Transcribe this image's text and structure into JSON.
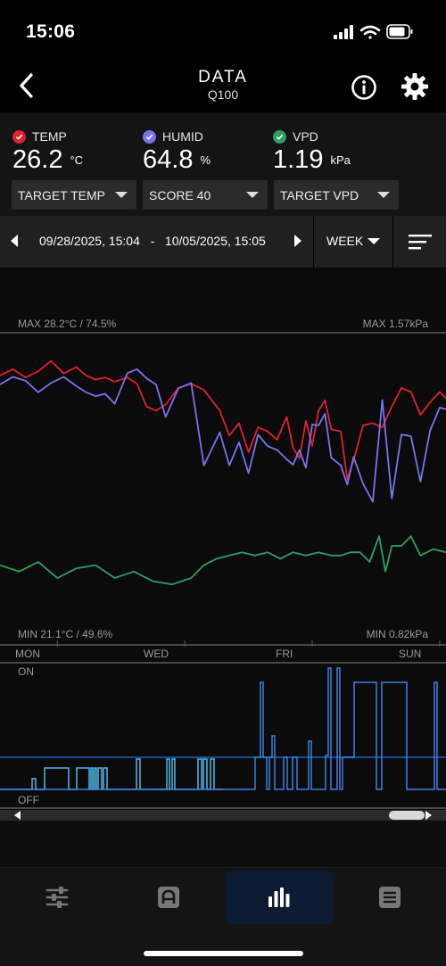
{
  "status": {
    "time": "15:06"
  },
  "nav": {
    "title": "DATA",
    "subtitle": "Q100"
  },
  "readings": [
    {
      "label": "TEMP",
      "value": "26.2",
      "unit": "°C",
      "color": "#e0202e"
    },
    {
      "label": "HUMID",
      "value": "64.8",
      "unit": "%",
      "color": "#7a73f0"
    },
    {
      "label": "VPD",
      "value": "1.19",
      "unit": "kPa",
      "color": "#2e9e62"
    }
  ],
  "dropdowns": [
    "TARGET TEMP",
    "SCORE 40",
    "TARGET VPD"
  ],
  "range": {
    "from": "09/28/2025, 15:04",
    "separator": "-",
    "to": "10/05/2025, 15:05",
    "period": "WEEK"
  },
  "chart_data": {
    "type": "line",
    "max_left": "MAX 28.2°C / 74.5%",
    "max_right": "MAX 1.57kPa",
    "min_left": "MIN 21.1°C / 49.6%",
    "min_right": "MIN 0.82kPa",
    "x_tick_labels": [
      "MON",
      "WED",
      "FRI",
      "SUN"
    ],
    "x_range_days": [
      0,
      7
    ],
    "temp_range": [
      21.1,
      28.2
    ],
    "humid_range": [
      49.6,
      74.5
    ],
    "vpd_range": [
      0.82,
      1.57
    ],
    "series": [
      {
        "name": "TEMP",
        "color": "#e0202e",
        "x": [
          0,
          0.2,
          0.4,
          0.6,
          0.8,
          1.0,
          1.2,
          1.35,
          1.5,
          1.65,
          1.8,
          2.0,
          2.15,
          2.3,
          2.45,
          2.6,
          2.8,
          3.0,
          3.2,
          3.45,
          3.6,
          3.75,
          3.9,
          4.05,
          4.2,
          4.35,
          4.5,
          4.6,
          4.7,
          4.8,
          4.9,
          5.0,
          5.1,
          5.2,
          5.35,
          5.45,
          5.55,
          5.7,
          5.85,
          6.0,
          6.15,
          6.3,
          6.45,
          6.6,
          6.75,
          6.9,
          7.0
        ],
        "y": [
          27.3,
          27.6,
          27.2,
          27.5,
          28.0,
          27.4,
          27.7,
          27.3,
          27.1,
          27.2,
          27.0,
          27.2,
          26.9,
          25.8,
          25.6,
          25.9,
          26.7,
          26.9,
          26.6,
          25.6,
          24.4,
          25.0,
          23.6,
          24.8,
          24.6,
          24.2,
          25.3,
          23.8,
          23.3,
          25.1,
          23.9,
          25.6,
          26.1,
          24.7,
          24.6,
          22.3,
          23.2,
          24.9,
          25.0,
          24.8,
          25.8,
          26.7,
          26.5,
          25.4,
          26.0,
          26.5,
          26.2
        ]
      },
      {
        "name": "HUMID",
        "color": "#7a73f0",
        "x": [
          0,
          0.2,
          0.4,
          0.6,
          0.8,
          1.0,
          1.2,
          1.35,
          1.5,
          1.65,
          1.8,
          2.0,
          2.15,
          2.3,
          2.45,
          2.6,
          2.8,
          3.0,
          3.2,
          3.45,
          3.6,
          3.75,
          3.9,
          4.05,
          4.2,
          4.35,
          4.5,
          4.6,
          4.7,
          4.8,
          4.9,
          5.0,
          5.1,
          5.2,
          5.35,
          5.45,
          5.55,
          5.7,
          5.85,
          6.0,
          6.15,
          6.3,
          6.45,
          6.6,
          6.75,
          6.9,
          7.0
        ],
        "y": [
          68.0,
          69.0,
          68.5,
          67.0,
          68.2,
          69.0,
          67.8,
          67.0,
          66.5,
          66.8,
          65.5,
          69.5,
          70.0,
          68.8,
          68.0,
          63.8,
          67.5,
          68.2,
          57.5,
          61.8,
          57.5,
          60.5,
          56.5,
          61.5,
          60.0,
          59.5,
          58.3,
          57.6,
          59.5,
          57.2,
          62.8,
          62.7,
          64.2,
          58.5,
          57.5,
          55.0,
          58.6,
          55.1,
          52.8,
          66.0,
          53.2,
          61.5,
          61.3,
          55.4,
          62.0,
          65.0,
          64.8
        ]
      },
      {
        "name": "VPD",
        "color": "#2e9e62",
        "x": [
          0,
          0.3,
          0.6,
          0.9,
          1.2,
          1.5,
          1.8,
          2.1,
          2.4,
          2.7,
          3.0,
          3.2,
          3.4,
          3.6,
          3.8,
          4.0,
          4.2,
          4.4,
          4.6,
          4.8,
          5.0,
          5.2,
          5.35,
          5.5,
          5.65,
          5.8,
          5.95,
          6.05,
          6.15,
          6.3,
          6.45,
          6.6,
          6.8,
          7.0
        ],
        "y": [
          1.06,
          1.04,
          1.07,
          1.02,
          1.05,
          1.06,
          1.02,
          1.04,
          1.01,
          1.0,
          1.02,
          1.06,
          1.08,
          1.09,
          1.1,
          1.09,
          1.1,
          1.08,
          1.1,
          1.09,
          1.1,
          1.09,
          1.09,
          1.1,
          1.1,
          1.07,
          1.15,
          1.04,
          1.12,
          1.12,
          1.15,
          1.09,
          1.11,
          1.1
        ]
      }
    ]
  },
  "status_strip": {
    "on_label": "ON",
    "off_label": "OFF"
  },
  "tabs": [
    {
      "name": "controls",
      "icon": "sliders-icon",
      "active": false
    },
    {
      "name": "device",
      "icon": "device-icon",
      "active": false
    },
    {
      "name": "data",
      "icon": "bar-chart-icon",
      "active": true
    },
    {
      "name": "log",
      "icon": "list-icon",
      "active": false
    }
  ]
}
